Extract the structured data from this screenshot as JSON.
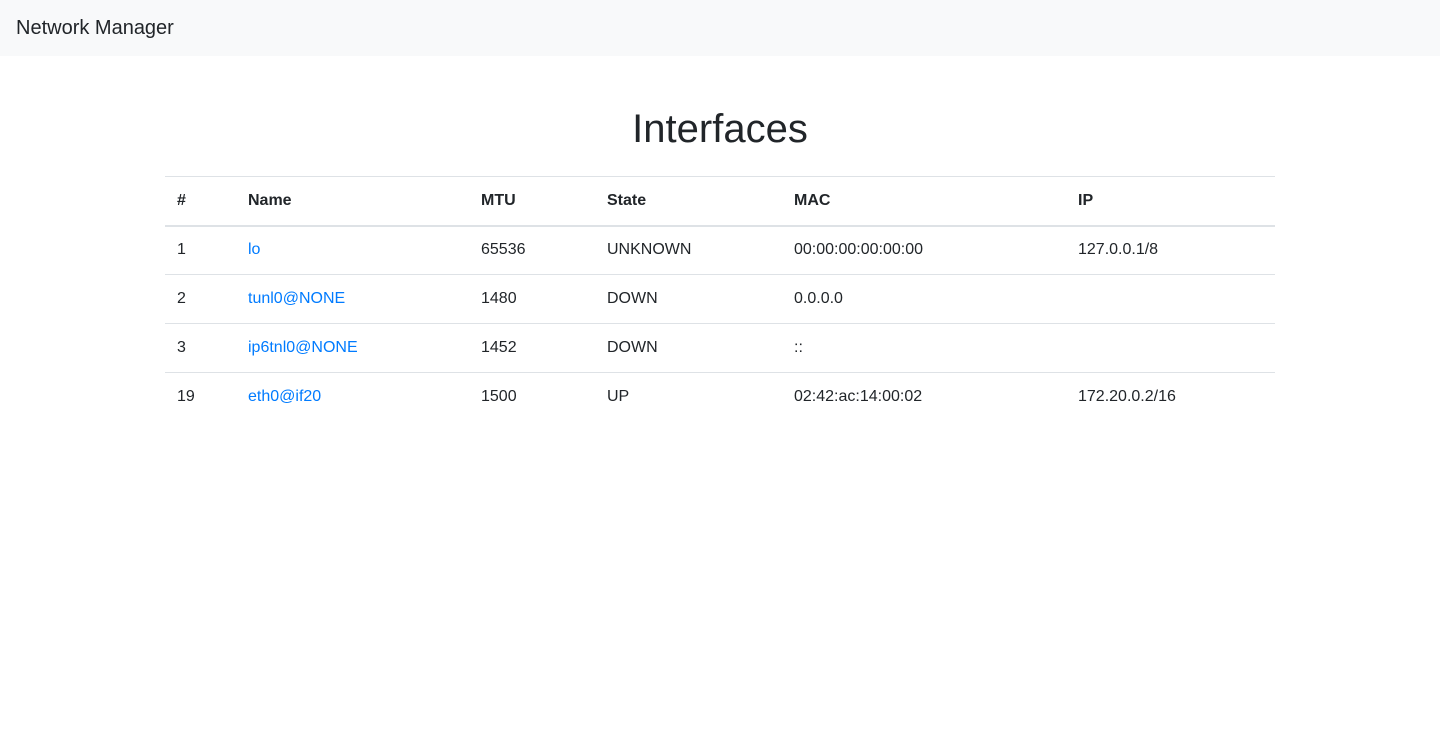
{
  "navbar": {
    "brand": "Network Manager"
  },
  "main": {
    "title": "Interfaces",
    "table": {
      "headers": [
        "#",
        "Name",
        "MTU",
        "State",
        "MAC",
        "IP"
      ],
      "rows": [
        {
          "index": "1",
          "name": "lo",
          "mtu": "65536",
          "state": "UNKNOWN",
          "mac": "00:00:00:00:00:00",
          "ip": "127.0.0.1/8"
        },
        {
          "index": "2",
          "name": "tunl0@NONE",
          "mtu": "1480",
          "state": "DOWN",
          "mac": "0.0.0.0",
          "ip": ""
        },
        {
          "index": "3",
          "name": "ip6tnl0@NONE",
          "mtu": "1452",
          "state": "DOWN",
          "mac": "::",
          "ip": ""
        },
        {
          "index": "19",
          "name": "eth0@if20",
          "mtu": "1500",
          "state": "UP",
          "mac": "02:42:ac:14:00:02",
          "ip": "172.20.0.2/16"
        }
      ]
    }
  },
  "colors": {
    "navbar_bg": "#f8f9fa",
    "link": "#007bff",
    "text": "#212529",
    "border": "#dee2e6"
  }
}
